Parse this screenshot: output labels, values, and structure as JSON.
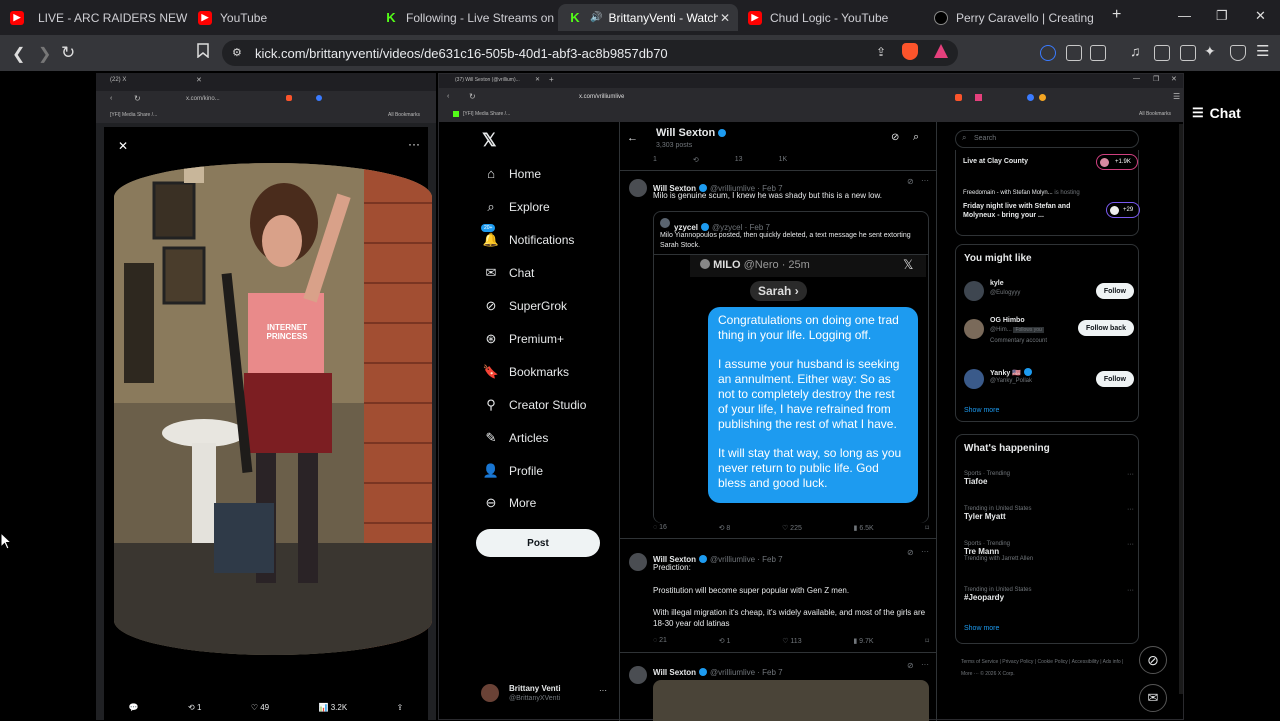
{
  "browser": {
    "tabs": [
      {
        "title": "LIVE - ARC RAIDERS NEW UP",
        "favicon": "youtube-icon"
      },
      {
        "title": "YouTube",
        "favicon": "youtube-icon"
      },
      {
        "title": "Following - Live Streams on Kick",
        "favicon": "kick-icon"
      },
      {
        "title": "BrittanyVenti - Watch the",
        "favicon": "kick-icon",
        "active": true
      },
      {
        "title": "Chud Logic - YouTube",
        "favicon": "youtube-icon"
      },
      {
        "title": "Perry Caravello | Creating Come",
        "favicon": "x-icon"
      }
    ],
    "new_tab": "+",
    "url": "kick.com/brittanyventi/videos/de631c16-505b-40d1-abf3-ac8b9857db70"
  },
  "chat_button": {
    "icon": "☰",
    "label": "Chat"
  },
  "left_window": {
    "tab_title": "(22) X",
    "url": "x.com/kino...",
    "bookmark": "[YFI] Media Share /...",
    "bookmarks_all": "All Bookmarks",
    "shirt_text": "INTERNET PRINCESS",
    "actions": {
      "reposts": "1",
      "likes": "49",
      "views": "3.2K"
    }
  },
  "right_window": {
    "tab_title": "(37) Will Sexton (@vrillium)...",
    "url": "x.com/vrilliumlive",
    "bookmark": "[YFI] Media Share /...",
    "bookmarks_all": "All Bookmarks",
    "nav": [
      {
        "icon": "home-icon",
        "label": "Home"
      },
      {
        "icon": "search-icon",
        "label": "Explore"
      },
      {
        "icon": "bell-icon",
        "label": "Notifications",
        "badge": "20+"
      },
      {
        "icon": "mail-icon",
        "label": "Chat"
      },
      {
        "icon": "grok-icon",
        "label": "SuperGrok"
      },
      {
        "icon": "premium-icon",
        "label": "Premium+"
      },
      {
        "icon": "bookmark-icon",
        "label": "Bookmarks"
      },
      {
        "icon": "creator-icon",
        "label": "Creator Studio"
      },
      {
        "icon": "article-icon",
        "label": "Articles"
      },
      {
        "icon": "person-icon",
        "label": "Profile"
      },
      {
        "icon": "more-icon",
        "label": "More"
      }
    ],
    "post_button": "Post",
    "account": {
      "name": "Brittany Venti",
      "handle": "@BrittanyXVenti"
    },
    "profile_header": {
      "name": "Will Sexton",
      "posts": "3,303 posts"
    },
    "top_actions": {
      "replies": "1",
      "likes": "13",
      "views": "1K"
    },
    "tweet1": {
      "name": "Will Sexton",
      "handle": "@vrilliumlive · Feb 7",
      "text": "Milo is genuine scum, I knew he was shady but this is a new low.",
      "quote": {
        "name": "yzycel",
        "handle": "@yzycel · Feb 7",
        "text": "Milo Yiannopoulos posted, then quickly deleted, a text message he sent extorting Sarah Stock."
      },
      "image": {
        "sender": "MILO",
        "sender_meta": "@Nero · 25m",
        "recipient": "Sarah",
        "message_1": "Congratulations on doing one trad thing in your life. Logging off.",
        "message_2": "I assume your husband is seeking an annulment. Either way: So as not to completely destroy the rest of your life, I have refrained from publishing the rest of what I have.",
        "message_3": "It will stay that way, so long as you never return to public life. God bless and good luck."
      },
      "actions": {
        "replies": "16",
        "reposts": "8",
        "likes": "225",
        "views": "6.5K"
      }
    },
    "tweet2": {
      "name": "Will Sexton",
      "handle": "@vrilliumlive · Feb 7",
      "line1": "Prediction:",
      "line2": "Prostitution will become super popular with Gen Z men.",
      "line3": "With illegal migration it's cheap, it's widely available, and most of the girls are 18-30 year old latinas",
      "actions": {
        "replies": "21",
        "reposts": "1",
        "likes": "113",
        "views": "9.7K"
      }
    },
    "tweet3": {
      "name": "Will Sexton",
      "handle": "@vrilliumlive · Feb 7"
    },
    "search_placeholder": "Search",
    "live": [
      {
        "title": "Live at Clay County",
        "count": "+1.9K"
      },
      {
        "host": "Freedomain - with Stefan Molyn...",
        "hosting": "is hosting",
        "title": "Friday night live with Stefan and Molyneux - bring your ...",
        "count": "+29"
      }
    ],
    "you_might_like": {
      "title": "You might like",
      "users": [
        {
          "name": "kyle",
          "handle": "@Eulogyyy",
          "button": "Follow"
        },
        {
          "name": "OG Himbo",
          "handle": "@Him...",
          "note": "Follows you",
          "sub": "Commentary account",
          "button": "Follow back"
        },
        {
          "name": "Yanky 🇺🇸",
          "handle": "@Yanky_Pollak",
          "button": "Follow"
        }
      ],
      "show_more": "Show more"
    },
    "whats_happening": {
      "title": "What's happening",
      "trends": [
        {
          "category": "Sports · Trending",
          "name": "Tiafoe"
        },
        {
          "category": "Trending in United States",
          "name": "Tyler Myatt"
        },
        {
          "category": "Sports · Trending",
          "name": "Tre Mann",
          "with": "Trending with Jarrett Allen"
        },
        {
          "category": "Trending in United States",
          "name": "#Jeopardy"
        }
      ],
      "show_more": "Show more"
    },
    "footer": "Terms of Service  |  Privacy Policy  |  Cookie Policy  |  Accessibility  |  Ads info  |  More ···  © 2026 X Corp."
  },
  "colors": {
    "accent": "#1d9bf0",
    "kick_green": "#53fc18",
    "bubble": "#1d9bf0"
  }
}
